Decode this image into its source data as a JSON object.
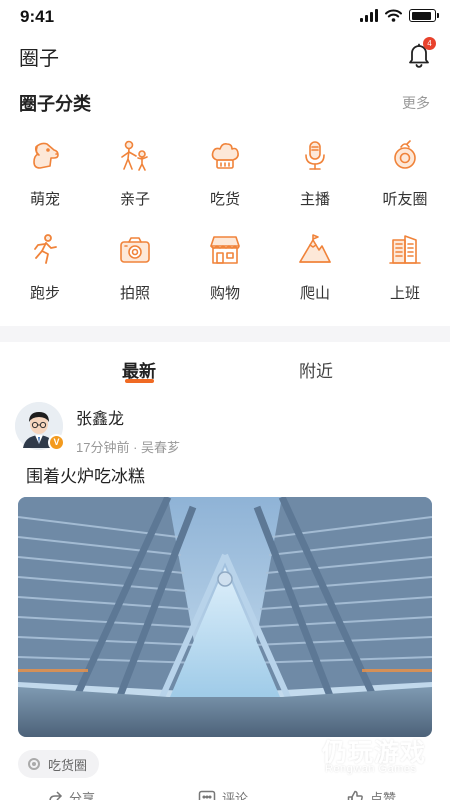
{
  "status_bar": {
    "time": "9:41",
    "battery_level": 0.9
  },
  "header": {
    "title": "圈子",
    "notification_count": "4"
  },
  "categories": {
    "title": "圈子分类",
    "more": "更多",
    "items": [
      {
        "label": "萌宠",
        "icon": "dog-icon"
      },
      {
        "label": "亲子",
        "icon": "parent-child-icon"
      },
      {
        "label": "吃货",
        "icon": "chef-hat-icon"
      },
      {
        "label": "主播",
        "icon": "microphone-icon"
      },
      {
        "label": "听友圈",
        "icon": "headphone-disc-icon"
      },
      {
        "label": "跑步",
        "icon": "running-icon"
      },
      {
        "label": "拍照",
        "icon": "camera-icon"
      },
      {
        "label": "购物",
        "icon": "shop-icon"
      },
      {
        "label": "爬山",
        "icon": "mountain-icon"
      },
      {
        "label": "上班",
        "icon": "office-building-icon"
      }
    ]
  },
  "tabs": {
    "latest": "最新",
    "nearby": "附近"
  },
  "post": {
    "author": "张鑫龙",
    "badge": "V",
    "meta": "17分钟前 · 吴春芗",
    "text": "围着火炉吃冰糕",
    "tag": "吃货圈",
    "actions": {
      "share": "分享",
      "comment": "评论",
      "like": "点赞"
    }
  },
  "watermark": {
    "text": "仍玩游戏",
    "sub": "Rengwan Games"
  },
  "colors": {
    "accent": "#f06a23",
    "icon_orange": "#f0833a",
    "badge_red": "#e8422c"
  }
}
